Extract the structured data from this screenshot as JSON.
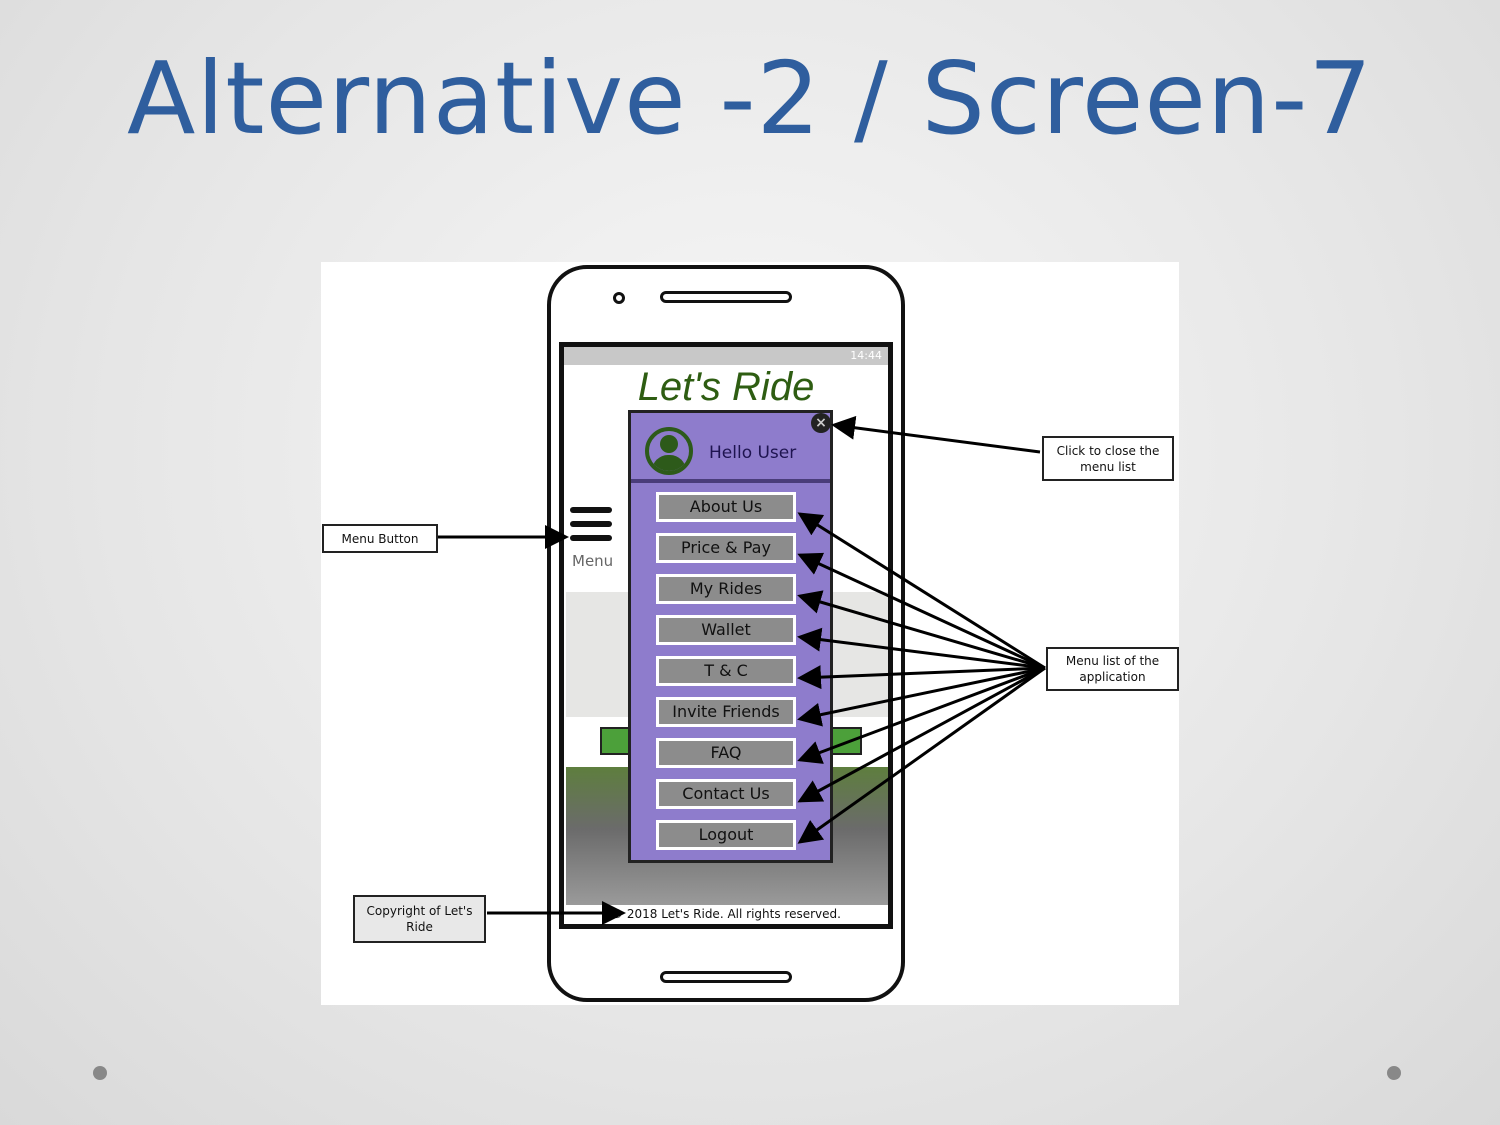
{
  "slide": {
    "title": "Alternative -2 / Screen-7"
  },
  "phone": {
    "status_bar": "14:44",
    "app_title": "Let's Ride",
    "menu_button_label": "Menu",
    "footer": "© 2018 Let's Ride. All rights reserved.",
    "menu": {
      "greeting": "Hello User",
      "close_icon": "close-icon",
      "items": [
        {
          "label": "About Us"
        },
        {
          "label": "Price & Pay"
        },
        {
          "label": "My Rides"
        },
        {
          "label": "Wallet"
        },
        {
          "label": "T & C"
        },
        {
          "label": "Invite Friends"
        },
        {
          "label": "FAQ"
        },
        {
          "label": "Contact Us"
        },
        {
          "label": "Logout"
        }
      ]
    }
  },
  "annotations": {
    "close": "Click to close the menu list",
    "menu_button": "Menu Button",
    "menu_list": "Menu list of the application",
    "copyright": "Copyright of Let's Ride"
  },
  "colors": {
    "title": "#2f5e9e",
    "menu_bg": "#8e7ccc",
    "button": "#8c8c8c",
    "app_title": "#2e5d12"
  }
}
